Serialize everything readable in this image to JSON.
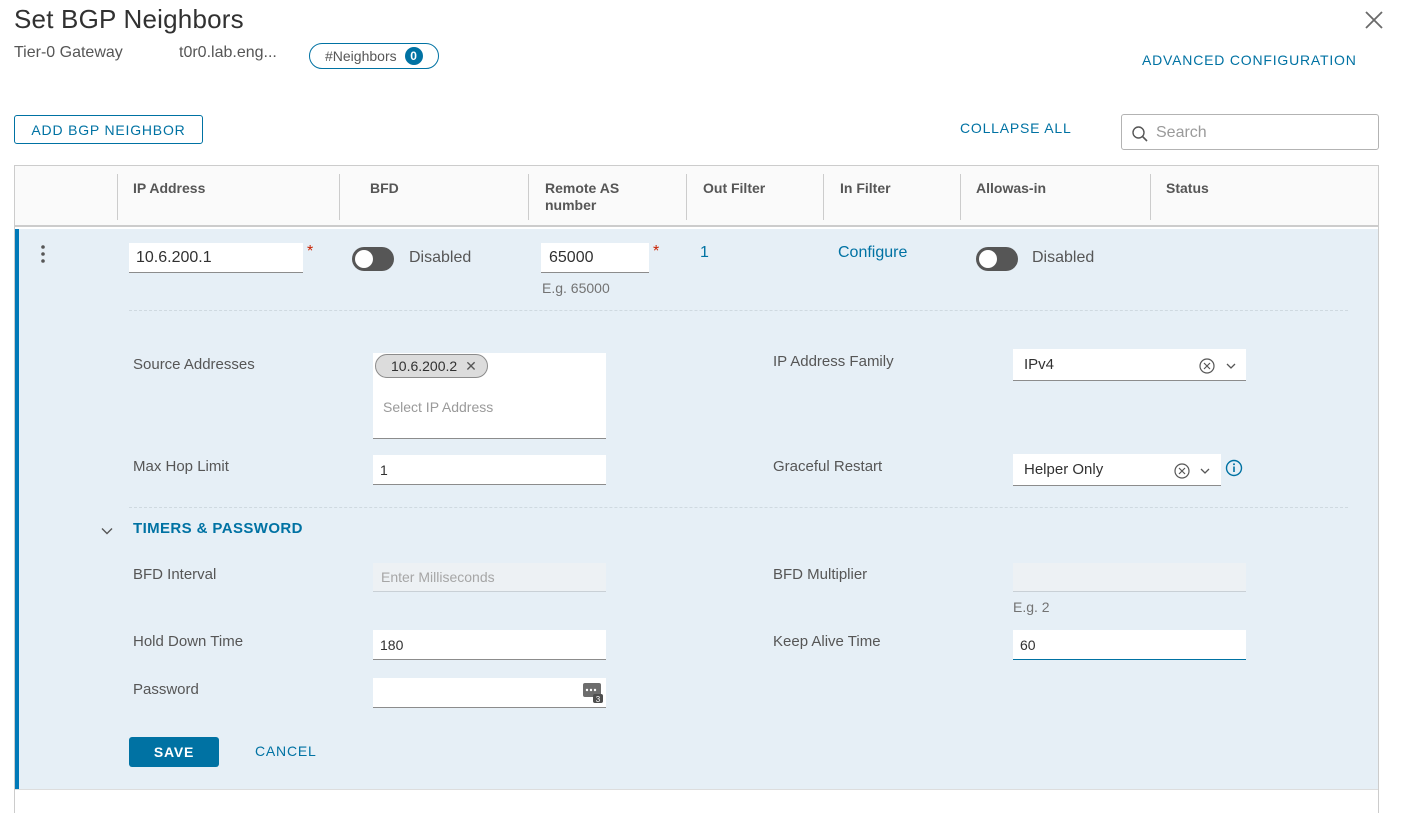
{
  "dialog": {
    "title": "Set BGP Neighbors",
    "gateway_label": "Tier-0 Gateway",
    "gateway_name": "t0r0.lab.eng...",
    "neighbors_pill_label": "#Neighbors",
    "neighbors_count": "0",
    "advanced_config_label": "ADVANCED CONFIGURATION"
  },
  "toolbar": {
    "add_label": "ADD BGP NEIGHBOR",
    "collapse_label": "COLLAPSE ALL",
    "search_placeholder": "Search"
  },
  "table": {
    "columns": [
      "IP Address",
      "BFD",
      "Remote AS number",
      "Out Filter",
      "In Filter",
      "Allowas-in",
      "Status"
    ]
  },
  "row": {
    "ip_address": "10.6.200.1",
    "bfd_state": "Disabled",
    "remote_as": "65000",
    "remote_as_hint": "E.g. 65000",
    "out_filter": "1",
    "in_filter": "Configure",
    "allowas_state": "Disabled",
    "required_mark": "*"
  },
  "details": {
    "source_addresses_label": "Source Addresses",
    "source_address_chip": "10.6.200.2",
    "source_addresses_placeholder": "Select IP Address",
    "ip_family_label": "IP Address Family",
    "ip_family_value": "IPv4",
    "max_hop_label": "Max Hop Limit",
    "max_hop_value": "1",
    "graceful_restart_label": "Graceful Restart",
    "graceful_restart_value": "Helper Only"
  },
  "timers": {
    "section_title": "TIMERS & PASSWORD",
    "bfd_interval_label": "BFD Interval",
    "bfd_interval_placeholder": "Enter Milliseconds",
    "bfd_multiplier_label": "BFD Multiplier",
    "bfd_multiplier_hint": "E.g. 2",
    "hold_down_label": "Hold Down Time",
    "hold_down_value": "180",
    "keep_alive_label": "Keep Alive Time",
    "keep_alive_value": "60",
    "password_label": "Password",
    "password_value": ""
  },
  "actions": {
    "save_label": "SAVE",
    "cancel_label": "CANCEL"
  },
  "colors": {
    "accent": "#0072a3",
    "panel_bg": "#e6eff6",
    "required": "#c92100"
  }
}
